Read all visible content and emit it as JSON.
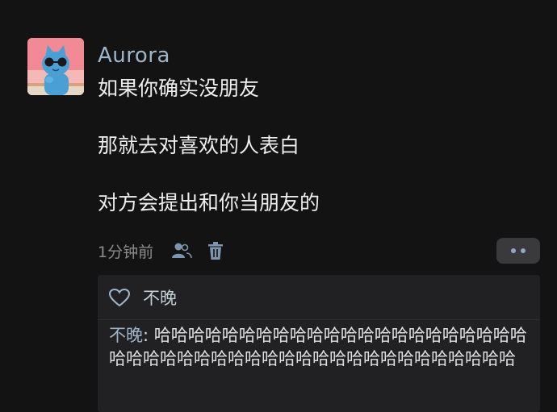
{
  "post": {
    "username": "Aurora",
    "lines": [
      "如果你确实没朋友",
      "那就去对喜欢的人表白",
      "对方会提出和你当朋友的"
    ],
    "time": "1分钟前"
  },
  "likes": {
    "names": "不晚"
  },
  "comment": {
    "author": "不晚",
    "separator": ": ",
    "text": "哈哈哈哈哈哈哈哈哈哈哈哈哈哈哈哈哈哈哈哈哈哈哈哈哈哈哈哈哈哈哈哈哈哈哈哈哈哈哈哈哈哈哈哈哈哈"
  },
  "icons": {
    "avatar": "blue-cat-with-sunglasses",
    "contacts": "people-icon",
    "delete": "trash-icon",
    "more": "more-dots-icon",
    "like": "heart-outline-icon"
  },
  "colors": {
    "background": "#131313",
    "username": "#9fb6c9",
    "reply_box": "#212124",
    "secondary_text": "#8c8c8c"
  }
}
